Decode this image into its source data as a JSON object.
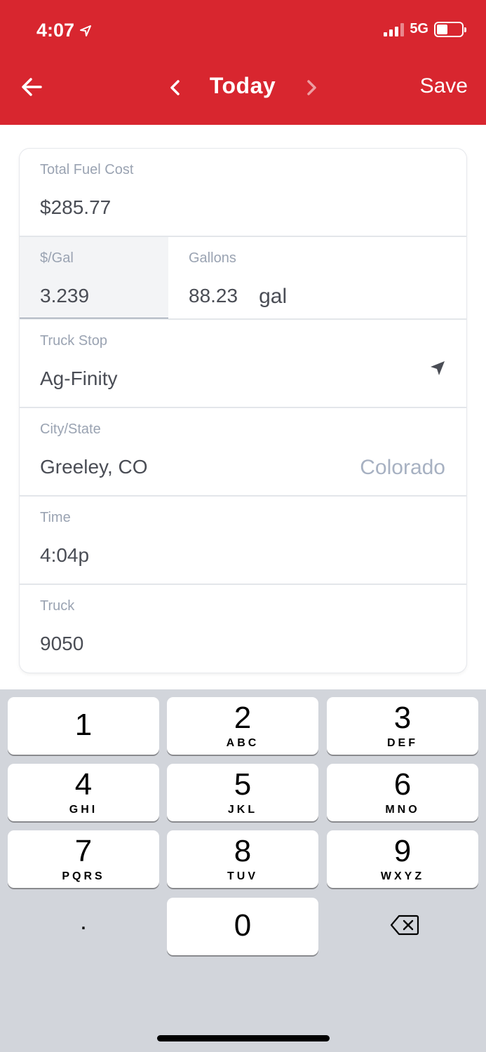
{
  "status_bar": {
    "time": "4:07",
    "network": "5G"
  },
  "header": {
    "title": "Today",
    "save_label": "Save"
  },
  "form": {
    "total_fuel_cost": {
      "label": "Total Fuel Cost",
      "value": "$285.77"
    },
    "price_per_gal": {
      "label": "$/Gal",
      "value": "3.239"
    },
    "gallons": {
      "label": "Gallons",
      "value": "88.23",
      "unit": "gal"
    },
    "truck_stop": {
      "label": "Truck Stop",
      "value": "Ag-Finity"
    },
    "city_state": {
      "label": "City/State",
      "value": "Greeley, CO",
      "hint": "Colorado"
    },
    "time": {
      "label": "Time",
      "value": "4:04p"
    },
    "truck": {
      "label": "Truck",
      "value": "9050"
    }
  },
  "keypad": {
    "keys": [
      {
        "digit": "1",
        "letters": ""
      },
      {
        "digit": "2",
        "letters": "ABC"
      },
      {
        "digit": "3",
        "letters": "DEF"
      },
      {
        "digit": "4",
        "letters": "GHI"
      },
      {
        "digit": "5",
        "letters": "JKL"
      },
      {
        "digit": "6",
        "letters": "MNO"
      },
      {
        "digit": "7",
        "letters": "PQRS"
      },
      {
        "digit": "8",
        "letters": "TUV"
      },
      {
        "digit": "9",
        "letters": "WXYZ"
      },
      {
        "digit": "0",
        "letters": ""
      }
    ],
    "dot_label": "."
  },
  "colors": {
    "brand_red": "#d8262f",
    "keyboard_bg": "#d2d5db"
  },
  "icons": [
    "back-arrow-icon",
    "chevron-left-icon",
    "chevron-right-icon",
    "location-arrow-icon",
    "backspace-icon",
    "signal-icon",
    "battery-icon"
  ]
}
